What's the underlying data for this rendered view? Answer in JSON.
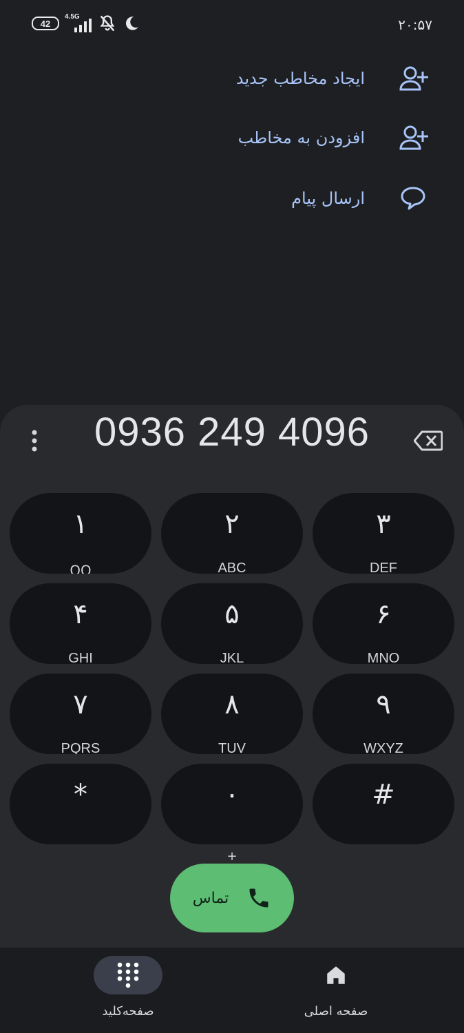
{
  "status_bar": {
    "time": "۲۰:۵۷",
    "battery": "42",
    "network": "4.5G"
  },
  "actions": [
    {
      "label": "ایجاد مخاطب جدید",
      "icon": "person-add-icon"
    },
    {
      "label": "افزودن به مخاطب",
      "icon": "person-add-icon"
    },
    {
      "label": "ارسال پیام",
      "icon": "message-bubble-icon"
    }
  ],
  "dialer": {
    "number": "0936 249 4096",
    "keys": [
      {
        "digit": "۱",
        "letters": "ᱛᱛ"
      },
      {
        "digit": "۲",
        "letters": "ABC"
      },
      {
        "digit": "۳",
        "letters": "DEF"
      },
      {
        "digit": "۴",
        "letters": "GHI"
      },
      {
        "digit": "۵",
        "letters": "JKL"
      },
      {
        "digit": "۶",
        "letters": "MNO"
      },
      {
        "digit": "۷",
        "letters": "PQRS"
      },
      {
        "digit": "۸",
        "letters": "TUV"
      },
      {
        "digit": "۹",
        "letters": "WXYZ"
      },
      {
        "digit": "*",
        "letters": ""
      },
      {
        "digit": "۰",
        "letters": "+"
      },
      {
        "digit": "#",
        "letters": ""
      }
    ],
    "call_label": "تماس"
  },
  "bottom_nav": {
    "keypad_label": "صفحه‌کلید",
    "home_label": "صفحه اصلی"
  },
  "colors": {
    "background": "#1d1f22",
    "sheet": "#282a2e",
    "key": "#131417",
    "accent_text": "#a8c4f8",
    "call_button": "#5cbd73"
  }
}
